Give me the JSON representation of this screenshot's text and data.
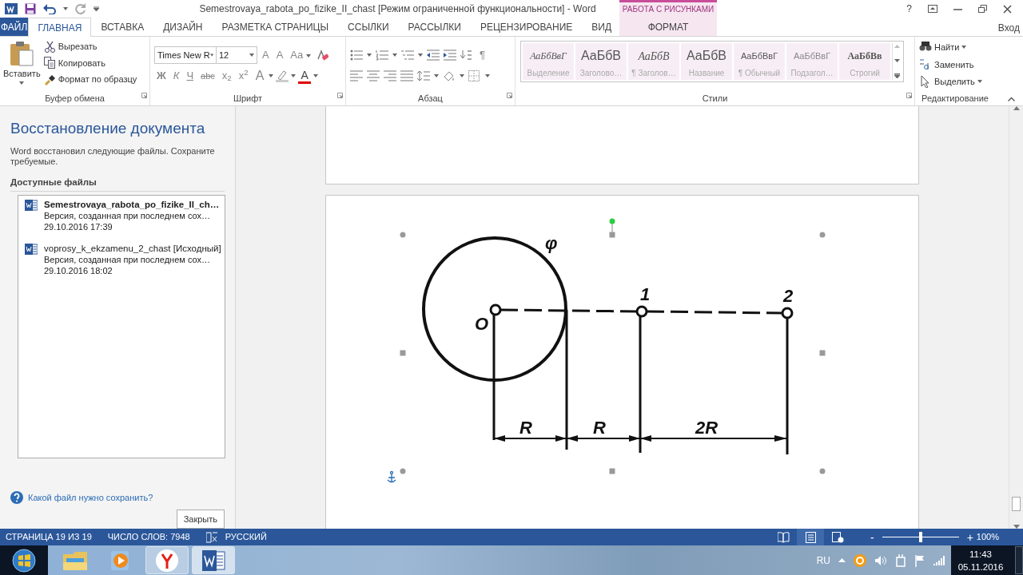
{
  "window": {
    "title": "Semestrovaya_rabota_po_fizike_II_chast [Режим ограниченной функциональности] - Word",
    "contextual_group": "РАБОТА С РИСУНКАМИ",
    "help": "?",
    "account": "Вход"
  },
  "tabs": [
    {
      "label": "ФАЙЛ",
      "kind": "file",
      "selected": false
    },
    {
      "label": "ГЛАВНАЯ",
      "kind": "normal",
      "selected": true
    },
    {
      "label": "ВСТАВКА",
      "kind": "normal",
      "selected": false
    },
    {
      "label": "ДИЗАЙН",
      "kind": "normal",
      "selected": false
    },
    {
      "label": "РАЗМЕТКА СТРАНИЦЫ",
      "kind": "normal",
      "selected": false
    },
    {
      "label": "ССЫЛКИ",
      "kind": "normal",
      "selected": false
    },
    {
      "label": "РАССЫЛКИ",
      "kind": "normal",
      "selected": false
    },
    {
      "label": "РЕЦЕНЗИРОВАНИЕ",
      "kind": "normal",
      "selected": false
    },
    {
      "label": "ВИД",
      "kind": "normal",
      "selected": false
    },
    {
      "label": "ФОРМАТ",
      "kind": "contextual",
      "selected": false
    }
  ],
  "ribbon": {
    "clipboard": {
      "title": "Буфер обмена",
      "paste": "Вставить",
      "commands": [
        {
          "kind": "cut",
          "label": "Вырезать"
        },
        {
          "kind": "copy",
          "label": "Копировать"
        },
        {
          "kind": "painter",
          "label": "Формат по образцу"
        }
      ]
    },
    "font": {
      "title": "Шрифт",
      "font_name": "Times New R",
      "font_size": "12",
      "grow": "A",
      "shrink": "A",
      "change_case": "Aa",
      "format": [
        {
          "kind": "bold",
          "label": "Ж"
        },
        {
          "kind": "italic",
          "label": "К"
        },
        {
          "kind": "underline",
          "label": "Ч"
        },
        {
          "kind": "strike",
          "label": "abc"
        },
        {
          "kind": "sub",
          "label": "x$_{2}$"
        },
        {
          "kind": "sup",
          "label": "x$^{2}$"
        }
      ],
      "effects": "A",
      "font_color": "A"
    },
    "paragraph": {
      "title": "Абзац",
      "pilcrow": "¶"
    },
    "styles": {
      "title": "Стили",
      "items": [
        {
          "preview": "АаБбВвГ",
          "name": "Выделение",
          "kind": "emphasis"
        },
        {
          "preview": "АаБбВ",
          "name": "Заголово…",
          "kind": "heading"
        },
        {
          "preview": "АаБбВ",
          "name": "¶ Заголов…",
          "kind": "heading2"
        },
        {
          "preview": "АаБбВ",
          "name": "Название",
          "kind": "title"
        },
        {
          "preview": "АаБбВвГ",
          "name": "¶ Обычный",
          "kind": "normal"
        },
        {
          "preview": "АаБбВвГ",
          "name": "Подзагол…",
          "kind": "subtitle"
        },
        {
          "preview": "АаБбВв",
          "name": "Строгий",
          "kind": "strong"
        }
      ]
    },
    "editing": {
      "title": "Редактирование",
      "commands": [
        {
          "kind": "find",
          "label": "Найти",
          "dropdown": true
        },
        {
          "kind": "replace",
          "label": "Заменить",
          "dropdown": false
        },
        {
          "kind": "select",
          "label": "Выделить",
          "dropdown": true
        }
      ]
    }
  },
  "recovery": {
    "title": "Восстановление документа",
    "message": "Word восстановил следующие файлы. Сохраните требуемые.",
    "section": "Доступные файлы",
    "files": [
      {
        "name": "Semestrovaya_rabota_po_fizike_II_ch…",
        "description": "Версия, созданная при последнем сох…",
        "date": "29.10.2016 17:39",
        "selected": true
      },
      {
        "name": "voprosy_k_ekzamenu_2_chast [Исходный]",
        "description": "Версия, созданная при последнем сох…",
        "date": "29.10.2016 18:02",
        "selected": false
      }
    ],
    "help_link": "Какой файл нужно сохранить?",
    "close": "Закрыть"
  },
  "figure": {
    "labels": [
      {
        "text": "φ",
        "kind": "phi"
      },
      {
        "text": "O",
        "kind": "origin"
      },
      {
        "text": "1",
        "kind": "point1"
      },
      {
        "text": "2",
        "kind": "point2"
      },
      {
        "text": "R",
        "kind": "span1"
      },
      {
        "text": "R",
        "kind": "span2"
      },
      {
        "text": "2R",
        "kind": "span3"
      }
    ]
  },
  "status_bar": {
    "page": "СТРАНИЦА 19 ИЗ 19",
    "words": "ЧИСЛО СЛОВ: 7948",
    "language": "РУССКИЙ",
    "views": [
      {
        "kind": "read",
        "selected": false
      },
      {
        "kind": "print",
        "selected": true
      },
      {
        "kind": "web",
        "selected": false
      }
    ],
    "zoom_out": "-",
    "zoom_in": "+",
    "zoom_slider": {
      "level": 0.5
    },
    "zoom": "100%"
  },
  "taskbar": {
    "apps": [
      {
        "kind": "explorer",
        "running": false,
        "selected": false
      },
      {
        "kind": "media",
        "running": false,
        "selected": false
      },
      {
        "kind": "browser",
        "running": true,
        "selected": false
      },
      {
        "kind": "word",
        "running": true,
        "selected": true
      }
    ],
    "language": "RU",
    "time": "11:43",
    "date": "05.11.2016"
  }
}
